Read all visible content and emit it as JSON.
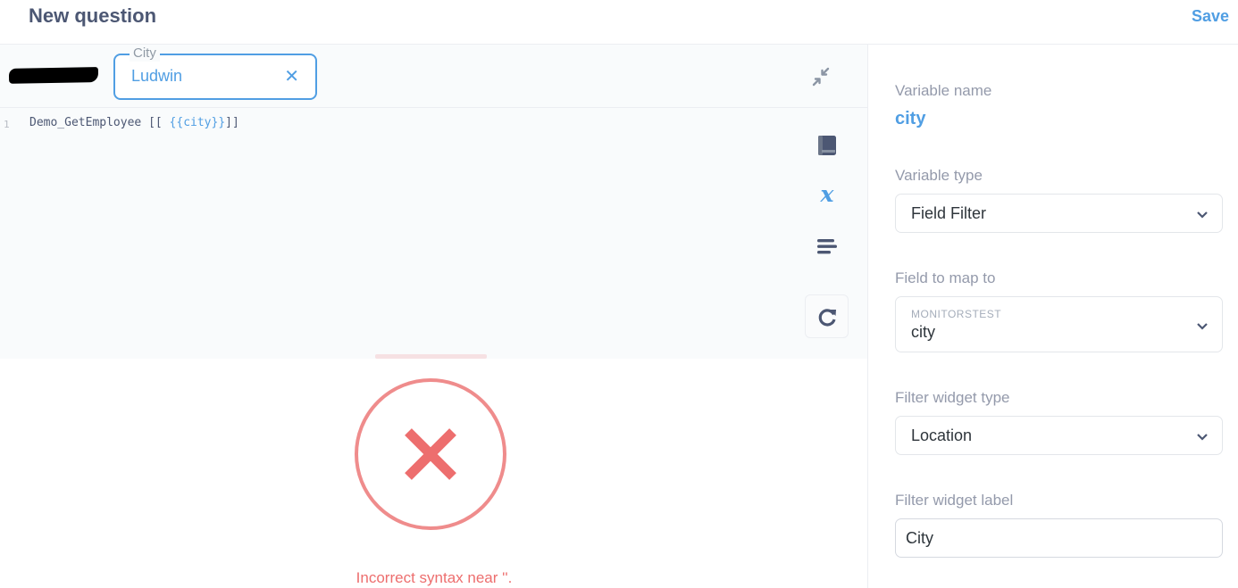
{
  "header": {
    "title": "New question",
    "save_label": "Save"
  },
  "parameter_widget": {
    "label": "City",
    "value": "Ludwin"
  },
  "editor": {
    "line_number": "1",
    "code_before": "Demo_GetEmployee ",
    "code_brackets_open": "[[ ",
    "code_tag": "{{city}}",
    "code_brackets_close": "]]"
  },
  "results": {
    "error_message": "Incorrect syntax near ''."
  },
  "sidebar": {
    "variable_name_label": "Variable name",
    "variable_name": "city",
    "variable_type_label": "Variable type",
    "variable_type": "Field Filter",
    "field_map_label": "Field to map to",
    "field_map_table": "MONITORSTEST",
    "field_map_field": "city",
    "widget_type_label": "Filter widget type",
    "widget_type": "Location",
    "widget_label_label": "Filter widget label",
    "widget_label_value": "City"
  },
  "colors": {
    "brand": "#509ee3",
    "error": "#ed6e6e",
    "text": "#4c5773"
  },
  "icons": [
    "collapse-icon",
    "close-icon",
    "book-icon",
    "variable-icon",
    "format-icon",
    "refresh-icon",
    "error-x-icon",
    "chevron-down-icon"
  ]
}
